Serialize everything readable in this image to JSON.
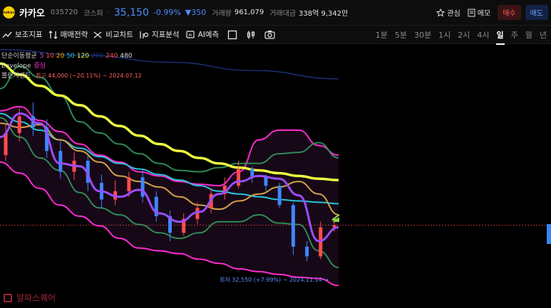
{
  "header": {
    "logo_text": "kakao",
    "name": "카카오",
    "code": "035720",
    "market": "코스피",
    "separator": "·",
    "price": "35,150",
    "change_pct": "-0.99%",
    "change_val": "▼350",
    "volume_label": "거래량",
    "volume": "961,079",
    "amount_label": "거래대금",
    "amount": "338억 9,342만",
    "watch_label": "관심",
    "memo_label": "메모",
    "buy_label": "매수",
    "sell_label": "매도"
  },
  "toolbar": {
    "indicators": "보조지표",
    "strategy": "매매전략",
    "compare": "비교차트",
    "analysis": "지표분석",
    "ai": "AI예측",
    "timeframes": [
      "1분",
      "5분",
      "30분",
      "1시",
      "2시",
      "4시",
      "일",
      "주",
      "월",
      "년"
    ],
    "active_timeframe": "일"
  },
  "legend": {
    "ma_label": "단순이동평균",
    "ma_periods": [
      {
        "text": "5",
        "color": "#e040fb"
      },
      {
        "text": "10",
        "color": "#ff5252"
      },
      {
        "text": "20",
        "color": "#ffb300"
      },
      {
        "text": "50",
        "color": "#26c6da"
      },
      {
        "text": "120",
        "color": "#eeff41"
      },
      {
        "text": "200",
        "color": "#1e3a8a"
      },
      {
        "text": "240",
        "color": "#ff5252"
      },
      {
        "text": "480",
        "color": "#e0e0e0"
      }
    ],
    "envelope_label": "Envelope",
    "envelope_value": "중심",
    "bollinger_label": "볼린저밴드"
  },
  "annotations": {
    "high": "최고 44,000 (−20.11%) − 2024.07.12",
    "low": "최저 32,550 (+7.99%) − 2024.11.14 →"
  },
  "watermark": "알파스퀘어",
  "colors": {
    "up": "#ff4d4d",
    "down": "#3f86ff",
    "ma5": "#9b4dff",
    "ma20": "#d4a04a",
    "ma50": "#26c6da",
    "ma120": "#eeff41",
    "ma200": "#1e3a8a",
    "envelope": "#ff2bd1",
    "bollinger": "#2e8b57"
  },
  "chart_data": {
    "type": "candlestick",
    "price_min": 30000,
    "price_max": 48000,
    "last_price": 35150,
    "ma120": [
      46800,
      46000,
      45200,
      44500,
      43800,
      43000,
      42300,
      41600,
      41000,
      40500,
      40000,
      39600,
      39300,
      39100,
      38900,
      38700,
      38500,
      38400
    ],
    "ma50": [
      43200,
      42600,
      42000,
      41300,
      40700,
      40100,
      39600,
      39200,
      38800,
      38400,
      38000,
      37600,
      37400,
      37200,
      37000,
      36900,
      36800,
      36700
    ],
    "ma20": [
      42500,
      42200,
      42400,
      41300,
      40500,
      39700,
      38700,
      38300,
      37900,
      37200,
      36600,
      36300,
      36900,
      37400,
      37900,
      38300,
      37400,
      35900
    ],
    "ma5": [
      41500,
      43200,
      42500,
      39600,
      39400,
      37600,
      37200,
      37700,
      36000,
      35400,
      36100,
      37400,
      38300,
      38700,
      38500,
      37300,
      34000,
      35000
    ],
    "ma200": [
      47800,
      47400,
      46900,
      46300,
      45700
    ],
    "env_upper": [
      43400,
      43700,
      42700,
      41900,
      41000,
      40200,
      39700,
      39000,
      38700,
      38300,
      38100,
      38000,
      39000,
      41300,
      42000,
      42000,
      40900,
      40200
    ],
    "env_lower": [
      39700,
      38900,
      37800,
      36600,
      35800,
      35100,
      34200,
      33500,
      33300,
      33100,
      32700,
      32400,
      32000,
      31800,
      31600,
      31400,
      31300,
      30800
    ],
    "bb_upper": [
      45000,
      46600,
      45800,
      44500,
      42600,
      41800,
      41000,
      40300,
      39600,
      39100,
      39000,
      39300,
      39600,
      39600,
      40300,
      40400,
      41100,
      40000
    ],
    "bb_lower": [
      42900,
      41500,
      40000,
      39100,
      37500,
      36400,
      35900,
      35200,
      34600,
      34200,
      34600,
      35400,
      35400,
      35900,
      35300,
      35200,
      33300,
      32100
    ],
    "candles": [
      {
        "o": 40200,
        "c": 41800,
        "h": 42500,
        "l": 39800
      },
      {
        "o": 41800,
        "c": 43000,
        "h": 43600,
        "l": 41200
      },
      {
        "o": 43000,
        "c": 42200,
        "h": 44000,
        "l": 41600
      },
      {
        "o": 42200,
        "c": 40500,
        "h": 42800,
        "l": 40000
      },
      {
        "o": 40500,
        "c": 39000,
        "h": 41200,
        "l": 38500
      },
      {
        "o": 39000,
        "c": 39800,
        "h": 40400,
        "l": 38400
      },
      {
        "o": 39800,
        "c": 38200,
        "h": 40200,
        "l": 37600
      },
      {
        "o": 38200,
        "c": 37000,
        "h": 38800,
        "l": 36400
      },
      {
        "o": 37000,
        "c": 37600,
        "h": 38400,
        "l": 36600
      },
      {
        "o": 37600,
        "c": 38600,
        "h": 39000,
        "l": 37200
      },
      {
        "o": 38600,
        "c": 37200,
        "h": 39200,
        "l": 36800
      },
      {
        "o": 37200,
        "c": 35800,
        "h": 37600,
        "l": 35400
      },
      {
        "o": 35800,
        "c": 34600,
        "h": 36200,
        "l": 34000
      },
      {
        "o": 34600,
        "c": 35600,
        "h": 36000,
        "l": 34400
      },
      {
        "o": 35600,
        "c": 36400,
        "h": 36800,
        "l": 35200
      },
      {
        "o": 36400,
        "c": 37400,
        "h": 37800,
        "l": 36000
      },
      {
        "o": 37400,
        "c": 38000,
        "h": 38600,
        "l": 37000
      },
      {
        "o": 38000,
        "c": 39200,
        "h": 39800,
        "l": 37800
      },
      {
        "o": 39200,
        "c": 38600,
        "h": 39400,
        "l": 38200
      },
      {
        "o": 38600,
        "c": 38000,
        "h": 38800,
        "l": 37600
      },
      {
        "o": 38000,
        "c": 36600,
        "h": 38200,
        "l": 36400
      },
      {
        "o": 36600,
        "c": 33600,
        "h": 36800,
        "l": 33000
      },
      {
        "o": 33600,
        "c": 32900,
        "h": 34000,
        "l": 32550
      },
      {
        "o": 32900,
        "c": 35000,
        "h": 35400,
        "l": 32700
      },
      {
        "o": 35000,
        "c": 35150,
        "h": 35600,
        "l": 34700
      }
    ]
  }
}
